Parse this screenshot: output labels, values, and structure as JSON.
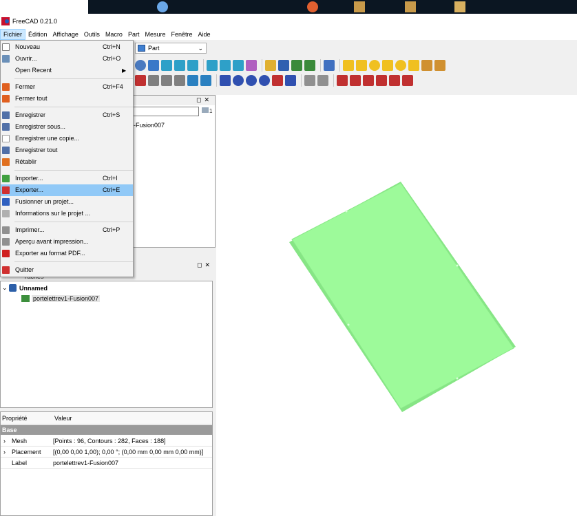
{
  "window": {
    "title": "FreeCAD 0.21.0"
  },
  "menubar": [
    "Fichier",
    "Édition",
    "Affichage",
    "Outils",
    "Macro",
    "Part",
    "Mesure",
    "Fenêtre",
    "Aide"
  ],
  "workbench": {
    "selected": "Part"
  },
  "file_menu": [
    {
      "label": "Nouveau",
      "shortcut": "Ctrl+N",
      "icon": "new-file-icon"
    },
    {
      "label": "Ouvrir...",
      "shortcut": "Ctrl+O",
      "icon": "open-folder-icon"
    },
    {
      "label": "Open Recent",
      "shortcut": "",
      "icon": "",
      "submenu": true
    },
    {
      "sep": true
    },
    {
      "label": "Fermer",
      "shortcut": "Ctrl+F4",
      "icon": "close-doc-icon"
    },
    {
      "label": "Fermer tout",
      "shortcut": "",
      "icon": "close-all-icon"
    },
    {
      "sep": true
    },
    {
      "label": "Enregistrer",
      "shortcut": "Ctrl+S",
      "icon": "save-icon"
    },
    {
      "label": "Enregistrer sous...",
      "shortcut": "",
      "icon": "save-as-icon"
    },
    {
      "label": "Enregistrer une copie...",
      "shortcut": "",
      "icon": "save-copy-icon"
    },
    {
      "label": "Enregistrer tout",
      "shortcut": "",
      "icon": "save-all-icon"
    },
    {
      "label": "Rétablir",
      "shortcut": "",
      "icon": "revert-icon"
    },
    {
      "sep": true
    },
    {
      "label": "Importer...",
      "shortcut": "Ctrl+I",
      "icon": "import-icon"
    },
    {
      "label": "Exporter...",
      "shortcut": "Ctrl+E",
      "icon": "export-icon",
      "highlighted": true
    },
    {
      "label": "Fusionner un projet...",
      "shortcut": "",
      "icon": "merge-icon"
    },
    {
      "label": "Informations sur le projet ...",
      "shortcut": "",
      "icon": "project-info-icon"
    },
    {
      "sep": true
    },
    {
      "label": "Imprimer...",
      "shortcut": "Ctrl+P",
      "icon": "print-icon"
    },
    {
      "label": "Aperçu avant impression...",
      "shortcut": "",
      "icon": "print-preview-icon"
    },
    {
      "label": "Exporter au format PDF...",
      "shortcut": "",
      "icon": "pdf-icon"
    },
    {
      "sep": true
    },
    {
      "label": "Quitter",
      "shortcut": "",
      "icon": "quit-icon"
    }
  ],
  "top_panel": {
    "filter_count": "1",
    "tree_text": "1-Fusion007"
  },
  "mid_panel": {
    "tab_text": "Tâches",
    "doc_name": "Unnamed",
    "object_name": "portelettrev1-Fusion007"
  },
  "properties": {
    "header_property": "Propriété",
    "header_value": "Valeur",
    "group": "Base",
    "rows": [
      {
        "expand": true,
        "name": "Mesh",
        "value": "[Points : 96, Contours : 282, Faces : 188]"
      },
      {
        "expand": true,
        "name": "Placement",
        "value": "[(0,00 0,00 1,00); 0,00 °; (0,00 mm  0,00 mm  0,00 mm)]"
      },
      {
        "expand": false,
        "name": "Label",
        "value": "portelettrev1-Fusion007"
      }
    ]
  },
  "colors": {
    "menu_highlight": "#91c9f7",
    "shape_fill": "#9dfa9a",
    "shape_shadow": "#86e585",
    "taskbar": "#0b1622"
  }
}
